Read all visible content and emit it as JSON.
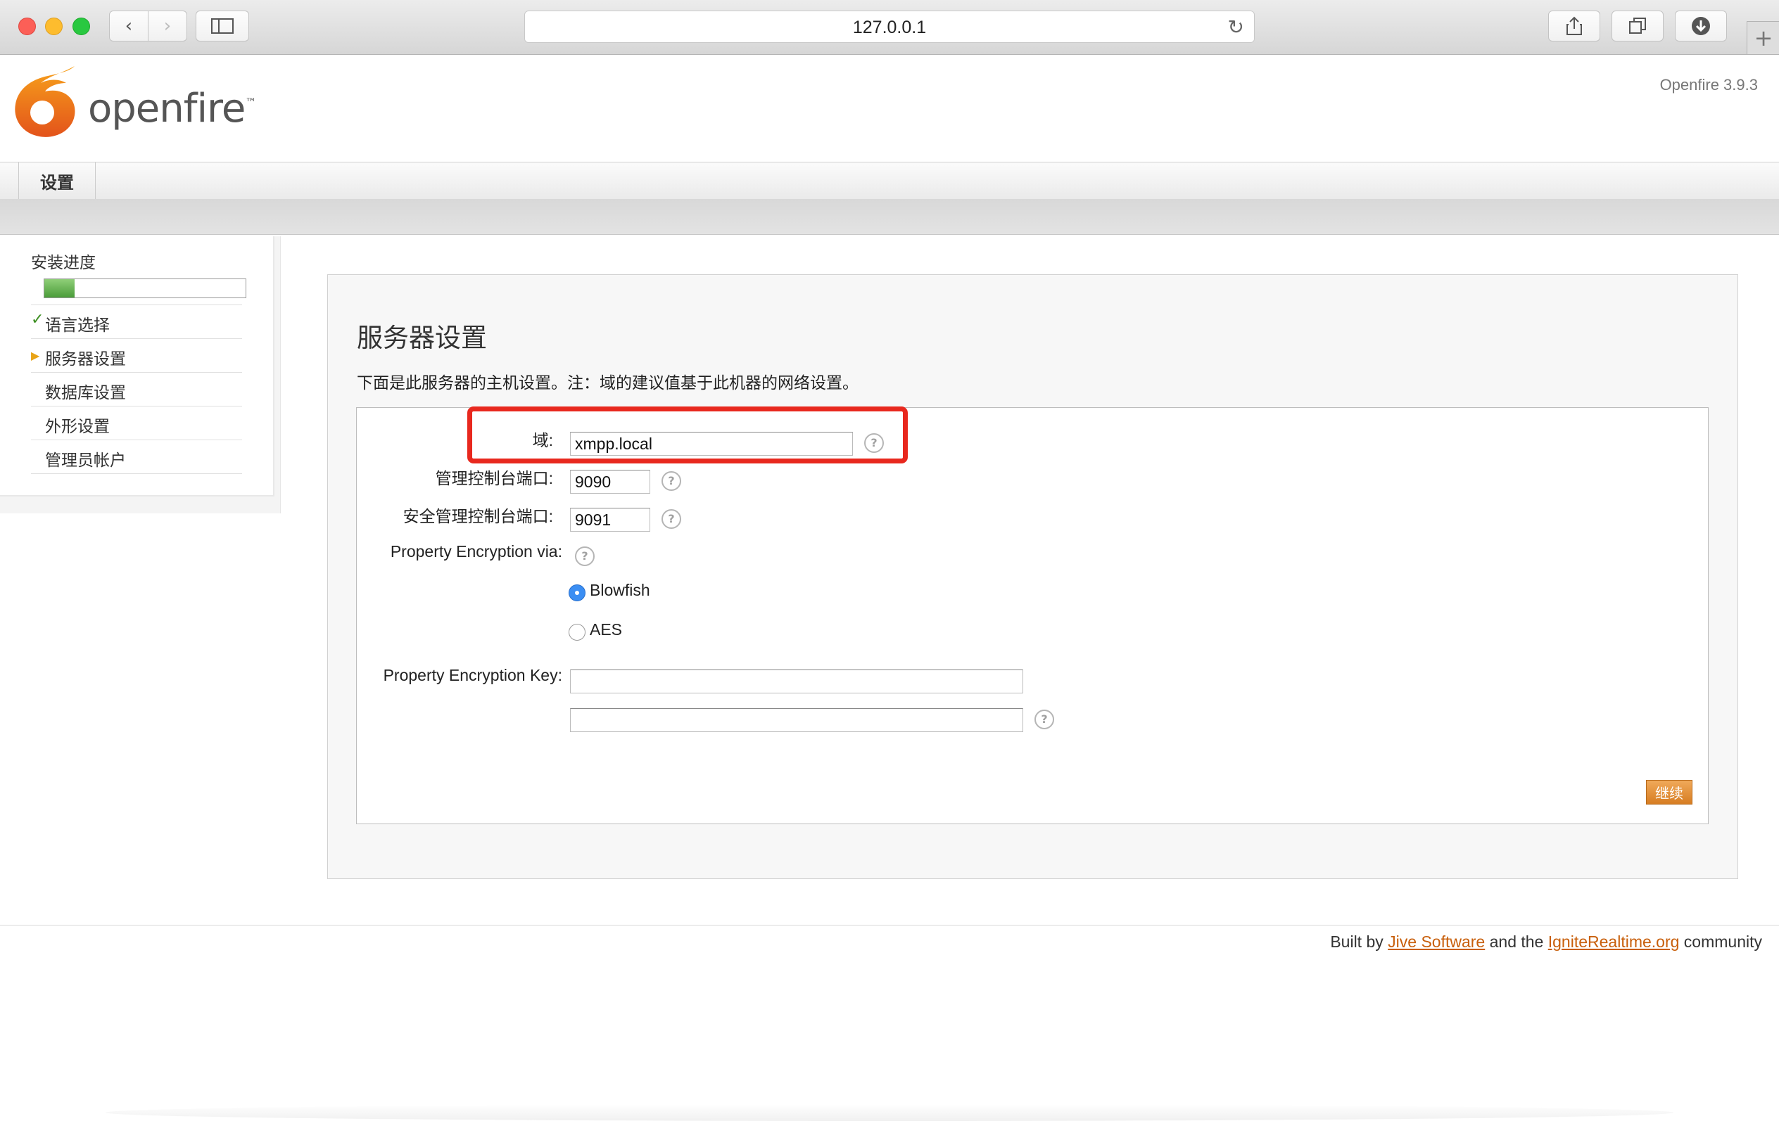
{
  "browser": {
    "url": "127.0.0.1",
    "icons": {
      "back": "chevron-left-icon",
      "forward": "chevron-right-icon",
      "sidebar": "sidebar-icon",
      "reload": "reload-icon",
      "share": "share-icon",
      "tabs": "tabs-icon",
      "download": "download-icon",
      "new_tab": "plus-icon"
    }
  },
  "header": {
    "brand": "openfire",
    "trademark": "™",
    "version": "Openfire 3.9.3"
  },
  "nav": {
    "tab": "设置"
  },
  "sidebar": {
    "progress_title": "安装进度",
    "progress_fraction": 0.15,
    "steps": [
      {
        "label": "语言选择",
        "status": "done"
      },
      {
        "label": "服务器设置",
        "status": "current"
      },
      {
        "label": "数据库设置",
        "status": "pending"
      },
      {
        "label": "外形设置",
        "status": "pending"
      },
      {
        "label": "管理员帐户",
        "status": "pending"
      }
    ]
  },
  "main": {
    "title": "服务器设置",
    "description": "下面是此服务器的主机设置。注：域的建议值基于此机器的网络设置。",
    "fields": {
      "domain": {
        "label": "域:",
        "value": "xmpp.local"
      },
      "admin_port": {
        "label": "管理控制台端口:",
        "value": "9090"
      },
      "secure_admin_port": {
        "label": "安全管理控制台端口:",
        "value": "9091"
      },
      "encryption_via": {
        "label": "Property Encryption via:"
      },
      "encryption_options": [
        {
          "label": "Blowfish",
          "selected": true
        },
        {
          "label": "AES",
          "selected": false
        }
      ],
      "encryption_key": {
        "label": "Property Encryption Key:",
        "value": "",
        "confirm_value": ""
      }
    },
    "help_glyph": "?",
    "continue_label": "继续",
    "highlight_color": "#e8281e"
  },
  "footer": {
    "prefix": "Built by ",
    "link1": "Jive Software",
    "middle": " and the ",
    "link2": "IgniteRealtime.org",
    "suffix": " community"
  }
}
